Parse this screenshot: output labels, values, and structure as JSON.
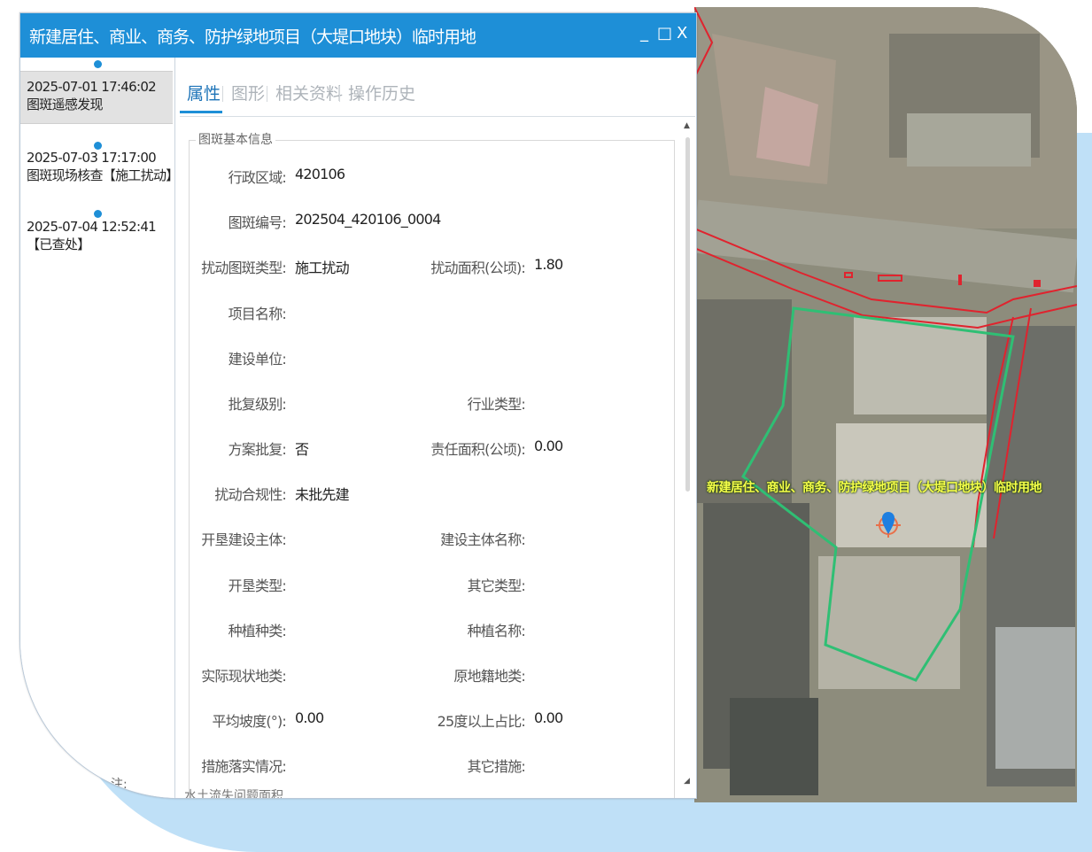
{
  "window": {
    "title": "新建居住、商业、商务、防护绿地项目（大堤口地块）临时用地",
    "minimize_label": "_",
    "maximize_label": "□",
    "close_label": "X"
  },
  "timeline": [
    {
      "time": "2025-07-01 17:46:02",
      "desc": "图斑遥感发现"
    },
    {
      "time": "2025-07-03 17:17:00",
      "desc": "图斑现场核查【施工扰动】"
    },
    {
      "time": "2025-07-04 12:52:41",
      "desc": "【已查处】"
    }
  ],
  "tabs": [
    "属性",
    "图形",
    "相关资料",
    "操作历史"
  ],
  "section_title": "图斑基本信息",
  "fields": {
    "admin_region": {
      "label": "行政区域:",
      "value": "420106"
    },
    "patch_id": {
      "label": "图斑编号:",
      "value": "202504_420106_0004"
    },
    "disturb_type": {
      "label": "扰动图斑类型:",
      "value": "施工扰动"
    },
    "disturb_area": {
      "label": "扰动面积(公顷):",
      "value": "1.80"
    },
    "project_name": {
      "label": "项目名称:",
      "value": ""
    },
    "builder": {
      "label": "建设单位:",
      "value": ""
    },
    "approval_level": {
      "label": "批复级别:",
      "value": ""
    },
    "industry_type": {
      "label": "行业类型:",
      "value": ""
    },
    "plan_approved": {
      "label": "方案批复:",
      "value": "否"
    },
    "resp_area": {
      "label": "责任面积(公顷):",
      "value": "0.00"
    },
    "compliance": {
      "label": "扰动合规性:",
      "value": "未批先建"
    },
    "dev_subject": {
      "label": "开垦建设主体:",
      "value": ""
    },
    "subject_name": {
      "label": "建设主体名称:",
      "value": ""
    },
    "dev_type": {
      "label": "开垦类型:",
      "value": ""
    },
    "other_type": {
      "label": "其它类型:",
      "value": ""
    },
    "plant_kind": {
      "label": "种植种类:",
      "value": ""
    },
    "plant_name": {
      "label": "种植名称:",
      "value": ""
    },
    "actual_landuse": {
      "label": "实际现状地类:",
      "value": ""
    },
    "orig_landuse": {
      "label": "原地籍地类:",
      "value": ""
    },
    "avg_slope": {
      "label": "平均坡度(°):",
      "value": "0.00"
    },
    "slope25_ratio": {
      "label": "25度以上占比:",
      "value": "0.00"
    },
    "measures_status": {
      "label": "措施落实情况:",
      "value": ""
    },
    "other_measures": {
      "label": "其它措施:",
      "value": ""
    }
  },
  "cut_row_text": "水土流失问题面积",
  "left_fragment": "注:",
  "map": {
    "label": "新建居住、商业、商务、防护绿地项目（大堤口地块）临时用地",
    "colors": {
      "boundary_green": "#2fbf74",
      "road_red": "#e0232e",
      "marker_blue": "#1e7fe0",
      "label_yellow": "#f5ff4a"
    }
  },
  "colors": {
    "titlebar": "#1e8fd7",
    "accent": "#1e74b8",
    "background_blob": "#bfe0f7"
  }
}
